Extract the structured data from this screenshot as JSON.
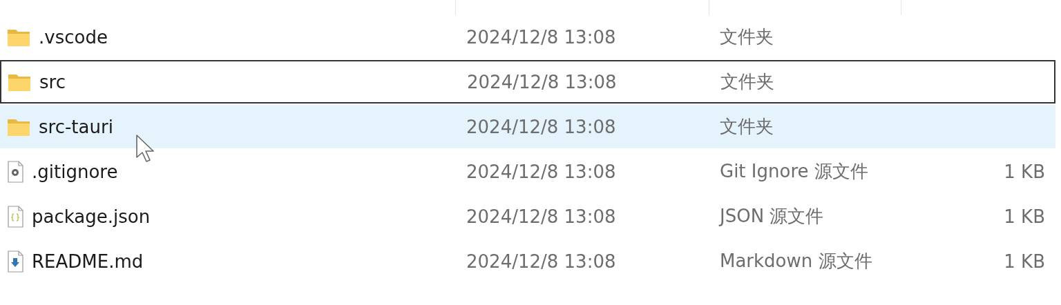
{
  "files": [
    {
      "kind": "folder",
      "name": ".vscode",
      "modified": "2024/12/8 13:08",
      "type": "文件夹",
      "focused": false,
      "hovered": false
    },
    {
      "kind": "folder",
      "name": "src",
      "modified": "2024/12/8 13:08",
      "type": "文件夹",
      "focused": true,
      "hovered": false
    },
    {
      "kind": "folder",
      "name": "src-tauri",
      "modified": "2024/12/8 13:08",
      "type": "文件夹",
      "focused": false,
      "hovered": true
    },
    {
      "kind": "settings",
      "name": ".gitignore",
      "modified": "2024/12/8 13:08",
      "type": "Git Ignore 源文件",
      "size": "1 KB",
      "focused": false,
      "hovered": false
    },
    {
      "kind": "json",
      "name": "package.json",
      "modified": "2024/12/8 13:08",
      "type": "JSON 源文件",
      "size": "1 KB",
      "focused": false,
      "hovered": false
    },
    {
      "kind": "markdown",
      "name": "README.md",
      "modified": "2024/12/8 13:08",
      "type": "Markdown 源文件",
      "size": "1 KB",
      "focused": false,
      "hovered": false
    }
  ]
}
